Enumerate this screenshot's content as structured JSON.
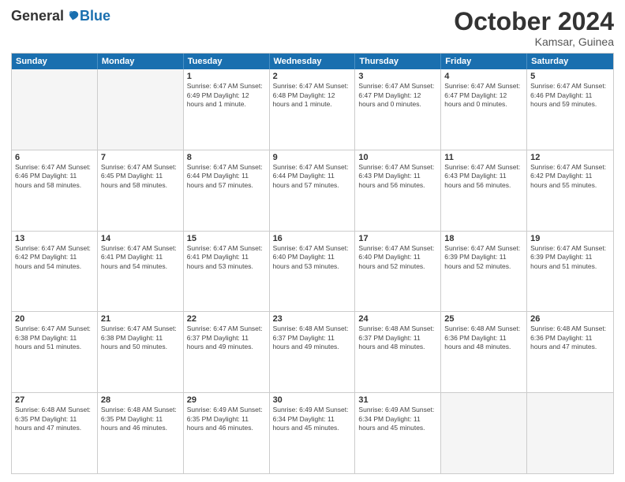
{
  "logo": {
    "general": "General",
    "blue": "Blue"
  },
  "title": "October 2024",
  "location": "Kamsar, Guinea",
  "header_days": [
    "Sunday",
    "Monday",
    "Tuesday",
    "Wednesday",
    "Thursday",
    "Friday",
    "Saturday"
  ],
  "weeks": [
    [
      {
        "day": "",
        "info": "",
        "empty": true
      },
      {
        "day": "",
        "info": "",
        "empty": true
      },
      {
        "day": "1",
        "info": "Sunrise: 6:47 AM\nSunset: 6:49 PM\nDaylight: 12 hours\nand 1 minute."
      },
      {
        "day": "2",
        "info": "Sunrise: 6:47 AM\nSunset: 6:48 PM\nDaylight: 12 hours\nand 1 minute."
      },
      {
        "day": "3",
        "info": "Sunrise: 6:47 AM\nSunset: 6:47 PM\nDaylight: 12 hours\nand 0 minutes."
      },
      {
        "day": "4",
        "info": "Sunrise: 6:47 AM\nSunset: 6:47 PM\nDaylight: 12 hours\nand 0 minutes."
      },
      {
        "day": "5",
        "info": "Sunrise: 6:47 AM\nSunset: 6:46 PM\nDaylight: 11 hours\nand 59 minutes."
      }
    ],
    [
      {
        "day": "6",
        "info": "Sunrise: 6:47 AM\nSunset: 6:46 PM\nDaylight: 11 hours\nand 58 minutes."
      },
      {
        "day": "7",
        "info": "Sunrise: 6:47 AM\nSunset: 6:45 PM\nDaylight: 11 hours\nand 58 minutes."
      },
      {
        "day": "8",
        "info": "Sunrise: 6:47 AM\nSunset: 6:44 PM\nDaylight: 11 hours\nand 57 minutes."
      },
      {
        "day": "9",
        "info": "Sunrise: 6:47 AM\nSunset: 6:44 PM\nDaylight: 11 hours\nand 57 minutes."
      },
      {
        "day": "10",
        "info": "Sunrise: 6:47 AM\nSunset: 6:43 PM\nDaylight: 11 hours\nand 56 minutes."
      },
      {
        "day": "11",
        "info": "Sunrise: 6:47 AM\nSunset: 6:43 PM\nDaylight: 11 hours\nand 56 minutes."
      },
      {
        "day": "12",
        "info": "Sunrise: 6:47 AM\nSunset: 6:42 PM\nDaylight: 11 hours\nand 55 minutes."
      }
    ],
    [
      {
        "day": "13",
        "info": "Sunrise: 6:47 AM\nSunset: 6:42 PM\nDaylight: 11 hours\nand 54 minutes."
      },
      {
        "day": "14",
        "info": "Sunrise: 6:47 AM\nSunset: 6:41 PM\nDaylight: 11 hours\nand 54 minutes."
      },
      {
        "day": "15",
        "info": "Sunrise: 6:47 AM\nSunset: 6:41 PM\nDaylight: 11 hours\nand 53 minutes."
      },
      {
        "day": "16",
        "info": "Sunrise: 6:47 AM\nSunset: 6:40 PM\nDaylight: 11 hours\nand 53 minutes."
      },
      {
        "day": "17",
        "info": "Sunrise: 6:47 AM\nSunset: 6:40 PM\nDaylight: 11 hours\nand 52 minutes."
      },
      {
        "day": "18",
        "info": "Sunrise: 6:47 AM\nSunset: 6:39 PM\nDaylight: 11 hours\nand 52 minutes."
      },
      {
        "day": "19",
        "info": "Sunrise: 6:47 AM\nSunset: 6:39 PM\nDaylight: 11 hours\nand 51 minutes."
      }
    ],
    [
      {
        "day": "20",
        "info": "Sunrise: 6:47 AM\nSunset: 6:38 PM\nDaylight: 11 hours\nand 51 minutes."
      },
      {
        "day": "21",
        "info": "Sunrise: 6:47 AM\nSunset: 6:38 PM\nDaylight: 11 hours\nand 50 minutes."
      },
      {
        "day": "22",
        "info": "Sunrise: 6:47 AM\nSunset: 6:37 PM\nDaylight: 11 hours\nand 49 minutes."
      },
      {
        "day": "23",
        "info": "Sunrise: 6:48 AM\nSunset: 6:37 PM\nDaylight: 11 hours\nand 49 minutes."
      },
      {
        "day": "24",
        "info": "Sunrise: 6:48 AM\nSunset: 6:37 PM\nDaylight: 11 hours\nand 48 minutes."
      },
      {
        "day": "25",
        "info": "Sunrise: 6:48 AM\nSunset: 6:36 PM\nDaylight: 11 hours\nand 48 minutes."
      },
      {
        "day": "26",
        "info": "Sunrise: 6:48 AM\nSunset: 6:36 PM\nDaylight: 11 hours\nand 47 minutes."
      }
    ],
    [
      {
        "day": "27",
        "info": "Sunrise: 6:48 AM\nSunset: 6:35 PM\nDaylight: 11 hours\nand 47 minutes."
      },
      {
        "day": "28",
        "info": "Sunrise: 6:48 AM\nSunset: 6:35 PM\nDaylight: 11 hours\nand 46 minutes."
      },
      {
        "day": "29",
        "info": "Sunrise: 6:49 AM\nSunset: 6:35 PM\nDaylight: 11 hours\nand 46 minutes."
      },
      {
        "day": "30",
        "info": "Sunrise: 6:49 AM\nSunset: 6:34 PM\nDaylight: 11 hours\nand 45 minutes."
      },
      {
        "day": "31",
        "info": "Sunrise: 6:49 AM\nSunset: 6:34 PM\nDaylight: 11 hours\nand 45 minutes."
      },
      {
        "day": "",
        "info": "",
        "empty": true
      },
      {
        "day": "",
        "info": "",
        "empty": true
      }
    ]
  ]
}
